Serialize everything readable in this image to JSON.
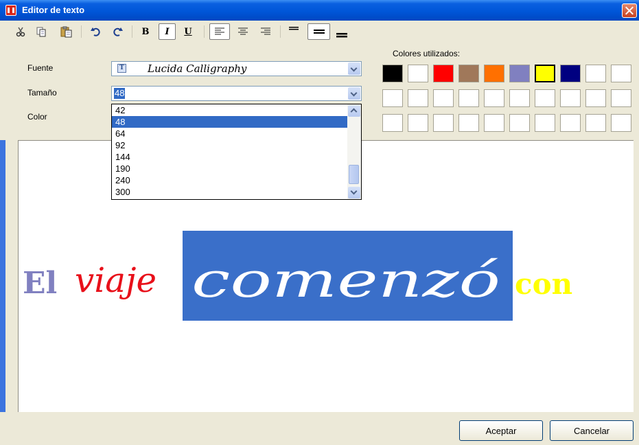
{
  "window": {
    "title": "Editor de texto"
  },
  "toolbar": {
    "bold_label": "B",
    "italic_label": "I",
    "underline_label": "U",
    "icons": [
      "cut-icon",
      "copy-icon",
      "paste-icon",
      "undo-icon",
      "redo-icon",
      "bold-icon",
      "italic-icon",
      "underline-icon",
      "align-left-icon",
      "align-center-icon",
      "align-right-icon",
      "line-thin-icon",
      "line-medium-icon",
      "line-thick-icon"
    ],
    "pressed": [
      "italic",
      "align-left",
      "line-medium"
    ]
  },
  "form": {
    "font_label": "Fuente",
    "font_value": "Lucida Calligraphy",
    "size_label": "Tamaño",
    "size_value": "48",
    "color_label": "Color"
  },
  "size_options": [
    "42",
    "48",
    "64",
    "92",
    "144",
    "190",
    "240",
    "300"
  ],
  "size_selected_index": 1,
  "colors": {
    "label": "Colores utilizados:",
    "selected_index": 6,
    "swatches": [
      "#000000",
      "#ffffff",
      "#ff0000",
      "#a0785a",
      "#ff7000",
      "#8080c0",
      "#ffff00",
      "#000080",
      "#ffffff",
      "#ffffff",
      "#ffffff",
      "#ffffff",
      "#ffffff",
      "#ffffff",
      "#ffffff",
      "#ffffff",
      "#ffffff",
      "#ffffff",
      "#ffffff",
      "#ffffff",
      "#ffffff",
      "#ffffff",
      "#ffffff",
      "#ffffff",
      "#ffffff",
      "#ffffff",
      "#ffffff",
      "#ffffff",
      "#ffffff",
      "#ffffff"
    ]
  },
  "canvas_words": [
    {
      "text": "El",
      "color": "#8080c0"
    },
    {
      "text": "viaje",
      "color": "#e8101a"
    },
    {
      "text": "comenzó",
      "color": "#ffffff",
      "background": "#3a6fc9"
    },
    {
      "text": "con",
      "color": "#ffff00"
    }
  ],
  "buttons": {
    "ok_label": "Aceptar",
    "cancel_label": "Cancelar"
  }
}
